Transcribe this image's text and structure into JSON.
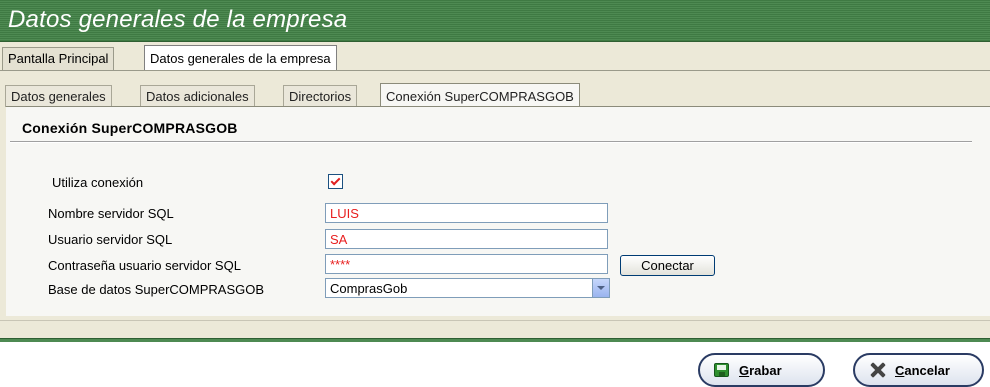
{
  "window": {
    "title": "Datos generales de la empresa"
  },
  "main_tabs": [
    {
      "label": "Pantalla Principal",
      "active": false
    },
    {
      "label": "Datos generales de la empresa",
      "active": true
    }
  ],
  "sub_tabs": [
    {
      "label": "Datos generales",
      "active": false
    },
    {
      "label": "Datos adicionales",
      "active": false
    },
    {
      "label": "Directorios",
      "active": false
    },
    {
      "label": "Conexión SuperCOMPRASGOB",
      "active": true
    }
  ],
  "section": {
    "title": "Conexión SuperCOMPRASGOB"
  },
  "form": {
    "use_connection": {
      "label": "Utiliza conexión",
      "checked": true
    },
    "server_name": {
      "label": "Nombre servidor SQL",
      "value": "LUIS"
    },
    "server_user": {
      "label": "Usuario servidor SQL",
      "value": "SA"
    },
    "server_password": {
      "label": "Contraseña usuario servidor SQL",
      "value": "****"
    },
    "database": {
      "label": "Base de datos SuperCOMPRASGOB",
      "value": "ComprasGob"
    },
    "connect_button": "Conectar"
  },
  "footer": {
    "save_prefix": "G",
    "save_rest": "rabar",
    "cancel_prefix": "C",
    "cancel_rest": "ancelar"
  },
  "colors": {
    "title_bar": "#4e8a52",
    "field_value": "#e81e1e",
    "check_mark": "#e02020"
  },
  "icons": [
    "checkmark-icon",
    "dropdown-arrow-icon",
    "save-icon",
    "cancel-icon"
  ]
}
